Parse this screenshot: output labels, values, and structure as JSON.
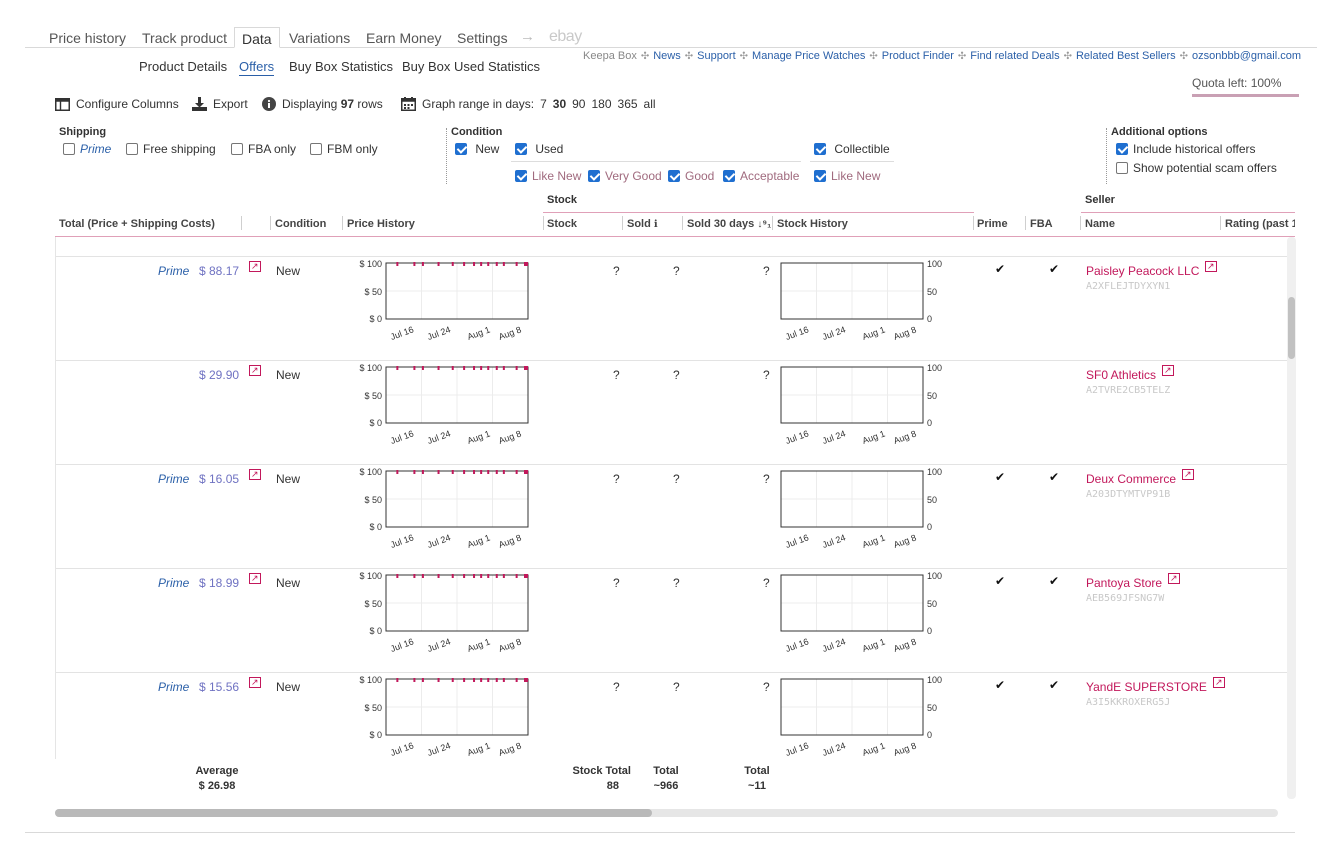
{
  "tabs": [
    {
      "label": "Price history",
      "active": false
    },
    {
      "label": "Track product",
      "active": false
    },
    {
      "label": "Data",
      "active": true
    },
    {
      "label": "Variations",
      "active": false
    },
    {
      "label": "Earn Money",
      "active": false
    },
    {
      "label": "Settings",
      "active": false
    }
  ],
  "tab_arrow": "→",
  "tab_ebay": "ebay",
  "subtabs": [
    {
      "label": "Product Details",
      "active": false
    },
    {
      "label": "Offers",
      "active": true
    },
    {
      "label": "Buy Box Statistics",
      "active": false
    },
    {
      "label": "Buy Box Used Statistics",
      "active": false
    }
  ],
  "toplinks": {
    "keepa_box": "Keepa Box",
    "links": [
      "News",
      "Support",
      "Manage Price Watches",
      "Product Finder",
      "Find related Deals",
      "Related Best Sellers",
      "ozsonbbb@gmail.com"
    ]
  },
  "quota": "Quota left: 100%",
  "toolbar": {
    "configure": "Configure Columns",
    "export": "Export",
    "displaying_prefix": "Displaying",
    "displaying_count": "97",
    "displaying_suffix": "rows",
    "range_label": "Graph range in days:",
    "range_options": [
      "7",
      "30",
      "90",
      "180",
      "365",
      "all"
    ],
    "range_selected": "30"
  },
  "filters": {
    "shipping": {
      "title": "Shipping",
      "options": [
        {
          "label": "Prime",
          "checked": false
        },
        {
          "label": "Free shipping",
          "checked": false
        },
        {
          "label": "FBA only",
          "checked": false
        },
        {
          "label": "FBM only",
          "checked": false
        }
      ]
    },
    "condition": {
      "title": "Condition",
      "new": {
        "label": "New",
        "checked": true
      },
      "used": {
        "label": "Used",
        "checked": true
      },
      "used_sub": [
        {
          "label": "Like New",
          "checked": true
        },
        {
          "label": "Very Good",
          "checked": true
        },
        {
          "label": "Good",
          "checked": true
        },
        {
          "label": "Acceptable",
          "checked": true
        }
      ],
      "collectible": {
        "label": "Collectible",
        "checked": true
      },
      "collectible_sub": [
        {
          "label": "Like New",
          "checked": true
        }
      ]
    },
    "additional": {
      "title": "Additional options",
      "options": [
        {
          "label": "Include historical offers",
          "checked": true
        },
        {
          "label": "Show potential scam offers",
          "checked": false
        }
      ]
    }
  },
  "groups": {
    "stock": "Stock",
    "seller": "Seller"
  },
  "columns": {
    "total": "Total (Price + Shipping Costs)",
    "condition": "Condition",
    "price_history": "Price History",
    "stock": "Stock",
    "sold": "Sold",
    "sold30": "Sold 30 days",
    "stock_history": "Stock History",
    "prime": "Prime",
    "fba": "FBA",
    "name": "Name",
    "rating": "Rating (past 1"
  },
  "chart_labels": {
    "price_y": [
      "$ 100",
      "$ 50",
      "$ 0"
    ],
    "stock_y": [
      "100",
      "50",
      "0"
    ],
    "x": [
      "Jul 16",
      "Jul 24",
      "Aug 1",
      "Aug 8"
    ]
  },
  "rows": [
    {
      "prime": "Prime",
      "price": "$ 88.17",
      "condition": "New",
      "stock": "?",
      "sold": "?",
      "sold30": "?",
      "is_prime": true,
      "is_fba": true,
      "seller": "Paisley Peacock LLC",
      "seller_id": "A2XFLEJTDYXYN1"
    },
    {
      "prime": "",
      "price": "$ 29.90",
      "condition": "New",
      "stock": "?",
      "sold": "?",
      "sold30": "?",
      "is_prime": false,
      "is_fba": false,
      "seller": "SF0 Athletics",
      "seller_id": "A2TVRE2CB5TELZ"
    },
    {
      "prime": "Prime",
      "price": "$ 16.05",
      "condition": "New",
      "stock": "?",
      "sold": "?",
      "sold30": "?",
      "is_prime": true,
      "is_fba": true,
      "seller": "Deux Commerce",
      "seller_id": "A203DTYMTVP91B"
    },
    {
      "prime": "Prime",
      "price": "$ 18.99",
      "condition": "New",
      "stock": "?",
      "sold": "?",
      "sold30": "?",
      "is_prime": true,
      "is_fba": true,
      "seller": "Pantoya Store",
      "seller_id": "AEB569JFSNG7W"
    },
    {
      "prime": "Prime",
      "price": "$ 15.56",
      "condition": "New",
      "stock": "?",
      "sold": "?",
      "sold30": "?",
      "is_prime": true,
      "is_fba": true,
      "seller": "YandE SUPERSTORE",
      "seller_id": "A3I5KKROXERG5J"
    }
  ],
  "footer": {
    "average_label": "Average",
    "average_value": "$ 26.98",
    "stock_total_label": "Stock Total",
    "stock_total_value": "88",
    "sold_total_label": "Total",
    "sold_total_value": "~966",
    "sold30_total_label": "Total",
    "sold30_total_value": "~11"
  },
  "colors": {
    "accent": "#c2185b",
    "link": "#2a5fa8",
    "price": "#6f72c2",
    "checkbox": "#1f6fd0"
  }
}
